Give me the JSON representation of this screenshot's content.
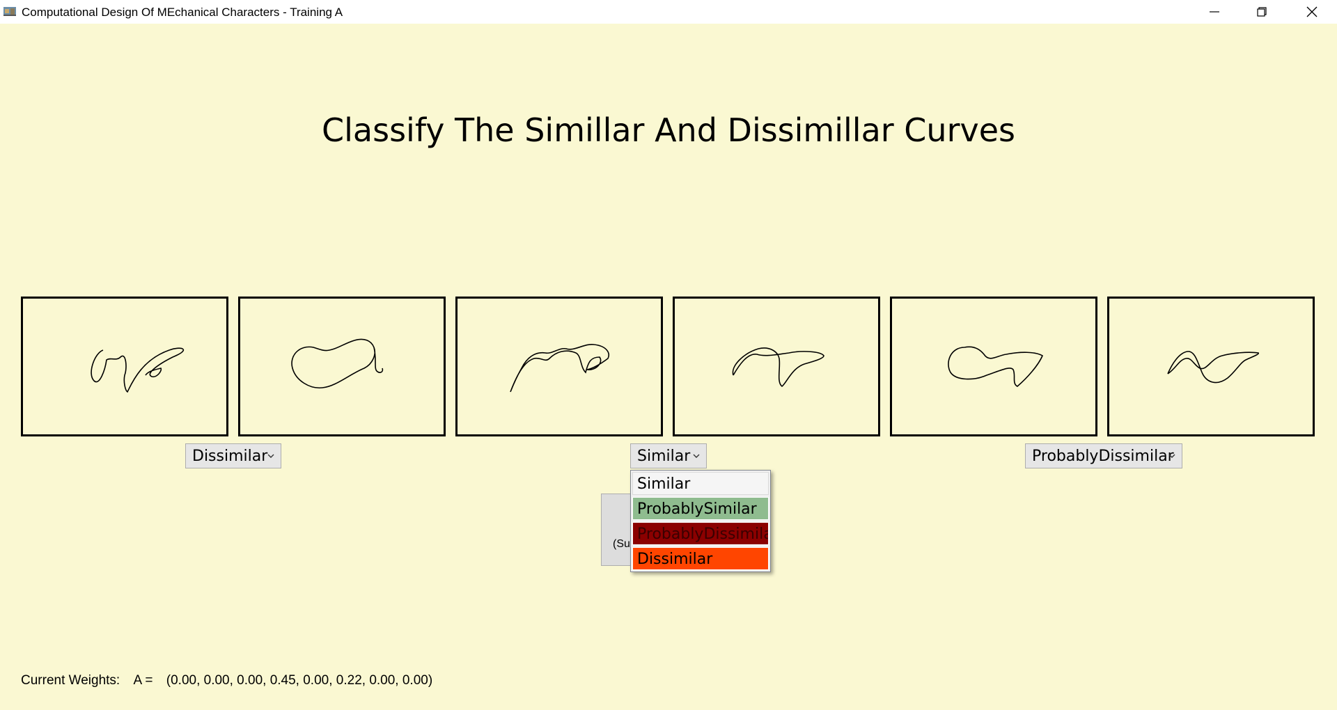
{
  "window": {
    "title": "Computational Design Of MEchanical Characters - Training A",
    "controls": {
      "minimize_icon": "minimize-icon",
      "maximize_icon": "restore-icon",
      "close_icon": "close-icon"
    }
  },
  "main": {
    "heading": "Classify The Simillar And Dissimillar Curves",
    "curves": [
      {
        "icon": "curve-1"
      },
      {
        "icon": "curve-2"
      },
      {
        "icon": "curve-3"
      },
      {
        "icon": "curve-4"
      },
      {
        "icon": "curve-5"
      },
      {
        "icon": "curve-6"
      }
    ],
    "classifiers": [
      {
        "selected": "Dissimilar"
      },
      {
        "selected": "Similar",
        "open": true
      },
      {
        "selected": "ProbablyDissimilar"
      }
    ],
    "dropdown_options": [
      {
        "label": "Similar",
        "color": "#F5F5F5"
      },
      {
        "label": "ProbablySimilar",
        "color": "#8FBC8F"
      },
      {
        "label": "ProbablyDissimilar",
        "color": "#8B0000"
      },
      {
        "label": "Dissimilar",
        "color": "#FF4500"
      }
    ],
    "submit_partial_label": "(Su"
  },
  "footer": {
    "weights_label": "Current Weights:",
    "weights_var": "A =",
    "weights_values": "(0.00, 0.00, 0.00, 0.45, 0.00, 0.22, 0.00, 0.00)"
  },
  "colors": {
    "background": "#FAF8D2",
    "titlebar": "#FFFFFF"
  }
}
